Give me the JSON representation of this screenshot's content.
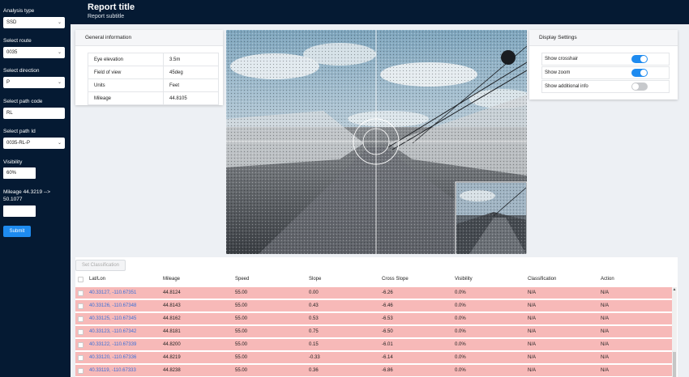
{
  "sidebar": {
    "analysis_type": {
      "label": "Analysis type",
      "value": "SSD"
    },
    "route": {
      "label": "Select route",
      "value": "0035"
    },
    "direction": {
      "label": "Select direction",
      "value": "P"
    },
    "path_code": {
      "label": "Select path code",
      "value": "RL"
    },
    "path_id": {
      "label": "Select path Id",
      "value": "0035-RL-P"
    },
    "visibility": {
      "label": "Visibility",
      "value": "60%"
    },
    "mileage": {
      "label_line1": "Mileage 44.3219 -->",
      "label_line2": "50.1077",
      "value": ""
    },
    "submit_label": "Submit"
  },
  "header": {
    "title": "Report title",
    "subtitle": "Report subtitle"
  },
  "general_info": {
    "title": "General information",
    "rows": [
      {
        "label": "Eye elevation",
        "value": "3.5m"
      },
      {
        "label": "Field of view",
        "value": "45deg"
      },
      {
        "label": "Units",
        "value": "Feet"
      },
      {
        "label": "Mileage",
        "value": "44.8105"
      }
    ]
  },
  "display_settings": {
    "title": "Display Settings",
    "items": [
      {
        "label": "Show crosshair",
        "on": true
      },
      {
        "label": "Show zoom",
        "on": true
      },
      {
        "label": "Show additional info",
        "on": false
      }
    ]
  },
  "table": {
    "set_classification_label": "Set Classification",
    "headers": [
      "Lat/Lon",
      "Mileage",
      "Speed",
      "Slope",
      "Cross Slope",
      "Visibility",
      "Classification",
      "Action"
    ],
    "rows": [
      [
        "40.33127, -110.67351",
        "44.8124",
        "55.00",
        "0.00",
        "-6.26",
        "0.0%",
        "N/A",
        "N/A"
      ],
      [
        "40.33126, -110.67348",
        "44.8143",
        "55.00",
        "0.43",
        "-6.46",
        "0.0%",
        "N/A",
        "N/A"
      ],
      [
        "40.33125, -110.67345",
        "44.8162",
        "55.00",
        "0.53",
        "-6.53",
        "0.0%",
        "N/A",
        "N/A"
      ],
      [
        "40.33123, -110.67342",
        "44.8181",
        "55.00",
        "0.75",
        "-6.50",
        "0.0%",
        "N/A",
        "N/A"
      ],
      [
        "40.33122, -110.67339",
        "44.8200",
        "55.00",
        "0.15",
        "-6.01",
        "0.0%",
        "N/A",
        "N/A"
      ],
      [
        "40.33120, -110.67336",
        "44.8219",
        "55.00",
        "-0.33",
        "-6.14",
        "0.0%",
        "N/A",
        "N/A"
      ],
      [
        "40.33119, -110.67333",
        "44.8238",
        "55.00",
        "0.36",
        "-6.86",
        "0.0%",
        "N/A",
        "N/A"
      ]
    ]
  },
  "icons": {
    "compass": "compass-icon",
    "chevron": "chevron-down-icon"
  },
  "colors": {
    "navy": "#051a33",
    "accent": "#1e8bf0",
    "row_highlight": "#f7b9b8",
    "link": "#3a6fd8"
  }
}
